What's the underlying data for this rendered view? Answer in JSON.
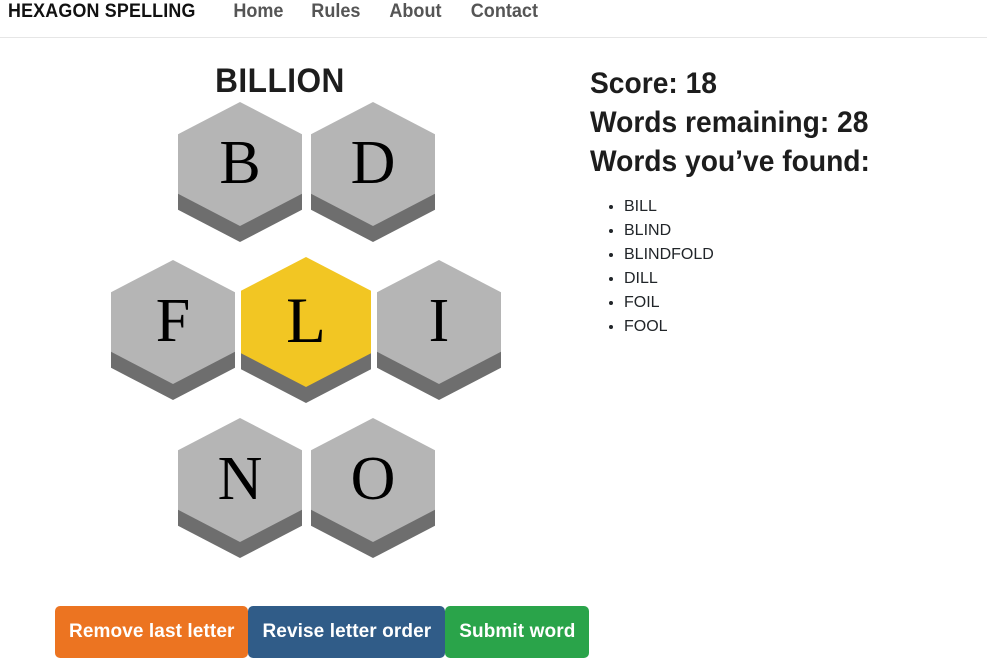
{
  "navbar": {
    "brand": "HEXAGON SPELLING",
    "links": [
      {
        "label": "Home"
      },
      {
        "label": "Rules"
      },
      {
        "label": "About"
      },
      {
        "label": "Contact"
      }
    ]
  },
  "game": {
    "current_word": "BILLION",
    "hive": {
      "center_letter": "L",
      "cells": [
        {
          "letter": "B",
          "highlight": false,
          "row": "top",
          "position": "top-left"
        },
        {
          "letter": "D",
          "highlight": false,
          "row": "top",
          "position": "top-right"
        },
        {
          "letter": "F",
          "highlight": false,
          "row": "middle",
          "position": "middle-left"
        },
        {
          "letter": "L",
          "highlight": true,
          "row": "middle",
          "position": "middle-center"
        },
        {
          "letter": "I",
          "highlight": false,
          "row": "middle",
          "position": "middle-right"
        },
        {
          "letter": "N",
          "highlight": false,
          "row": "bottom",
          "position": "bottom-left"
        },
        {
          "letter": "O",
          "highlight": false,
          "row": "bottom",
          "position": "bottom-right"
        }
      ]
    },
    "buttons": {
      "remove_last_letter": "Remove last letter",
      "revise_letter_order": "Revise letter order",
      "submit_word": "Submit word"
    }
  },
  "status": {
    "score_line": "Score: 18",
    "score_value": 18,
    "words_remaining_line": "Words remaining: 28",
    "words_remaining_value": 28,
    "found_heading": "Words you’ve found:",
    "found_words": [
      "BILL",
      "BLIND",
      "BLINDFOLD",
      "DILL",
      "FOIL",
      "FOOL"
    ]
  },
  "colors": {
    "hex_default": "#b5b5b5",
    "hex_highlight": "#f2c623",
    "hex_shadow": "#6e6e6e",
    "btn_remove": "#ec7421",
    "btn_revise": "#305c88",
    "btn_submit": "#2aa44a",
    "text": "#212529",
    "nav_link": "#555555"
  }
}
